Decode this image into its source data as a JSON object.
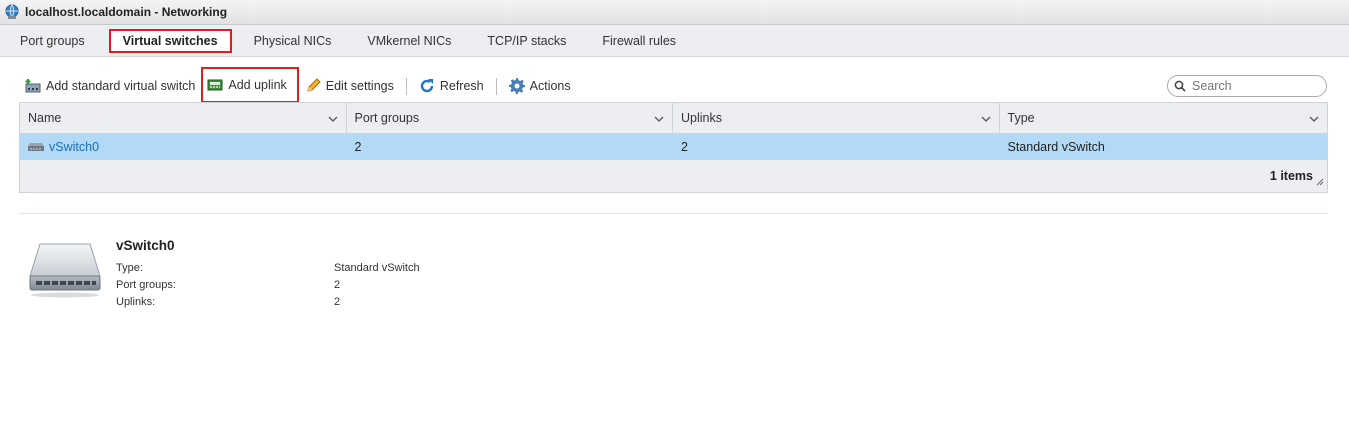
{
  "window": {
    "title": "localhost.localdomain - Networking",
    "icon": "globe-network-icon"
  },
  "tabs": [
    {
      "label": "Port groups",
      "active": false
    },
    {
      "label": "Virtual switches",
      "active": true
    },
    {
      "label": "Physical NICs",
      "active": false
    },
    {
      "label": "VMkernel NICs",
      "active": false
    },
    {
      "label": "TCP/IP stacks",
      "active": false
    },
    {
      "label": "Firewall rules",
      "active": false
    }
  ],
  "toolbar": {
    "add_vswitch_label": "Add standard virtual switch",
    "add_uplink_label": "Add uplink",
    "edit_settings_label": "Edit settings",
    "refresh_label": "Refresh",
    "actions_label": "Actions"
  },
  "search": {
    "placeholder": "Search",
    "value": ""
  },
  "grid": {
    "columns": [
      "Name",
      "Port groups",
      "Uplinks",
      "Type"
    ],
    "rows": [
      {
        "name": "vSwitch0",
        "port_groups": "2",
        "uplinks": "2",
        "type": "Standard vSwitch",
        "selected": true
      }
    ],
    "footer": "1 items"
  },
  "detail": {
    "title": "vSwitch0",
    "icon": "network-switch-icon",
    "properties": [
      {
        "label": "Type:",
        "value": "Standard vSwitch"
      },
      {
        "label": "Port groups:",
        "value": "2"
      },
      {
        "label": "Uplinks:",
        "value": "2"
      }
    ]
  },
  "colors": {
    "selected_row": "#b2daf6",
    "highlight_box": "#e31c1c",
    "link": "#1a6eb5"
  }
}
